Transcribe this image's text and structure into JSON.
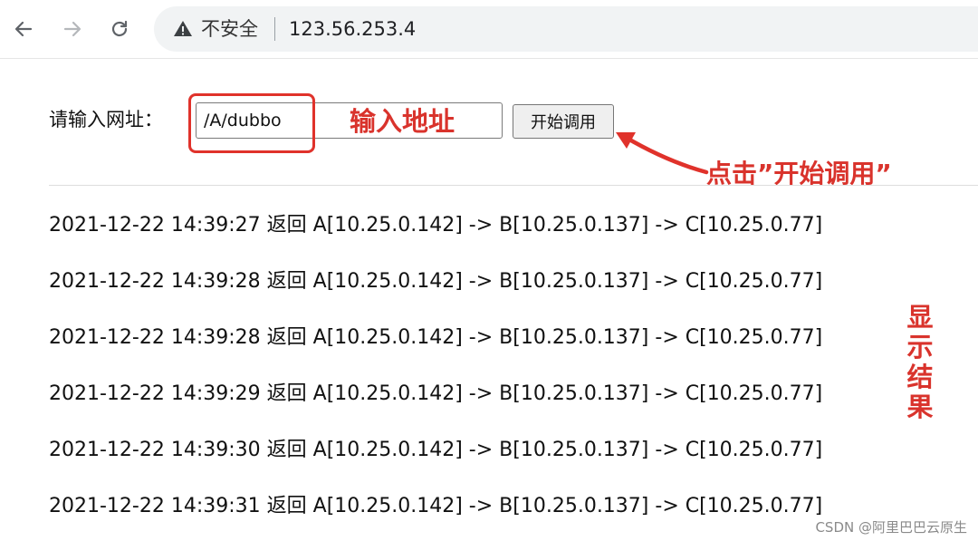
{
  "browser": {
    "security_label": "不安全",
    "url": "123.56.253.4"
  },
  "form": {
    "label": "请输入网址：",
    "input_value": "/A/dubbo",
    "button_label": "开始调用"
  },
  "annotations": {
    "input_hint": "输入地址",
    "click_hint": "点击”开始调用”",
    "result_hint": "显示结果",
    "color": "#d9332c"
  },
  "results": [
    "2021-12-22 14:39:27 返回 A[10.25.0.142] -> B[10.25.0.137] -> C[10.25.0.77]",
    "2021-12-22 14:39:28 返回 A[10.25.0.142] -> B[10.25.0.137] -> C[10.25.0.77]",
    "2021-12-22 14:39:28 返回 A[10.25.0.142] -> B[10.25.0.137] -> C[10.25.0.77]",
    "2021-12-22 14:39:29 返回 A[10.25.0.142] -> B[10.25.0.137] -> C[10.25.0.77]",
    "2021-12-22 14:39:30 返回 A[10.25.0.142] -> B[10.25.0.137] -> C[10.25.0.77]",
    "2021-12-22 14:39:31 返回 A[10.25.0.142] -> B[10.25.0.137] -> C[10.25.0.77]"
  ],
  "watermark": "CSDN @阿里巴巴云原生"
}
